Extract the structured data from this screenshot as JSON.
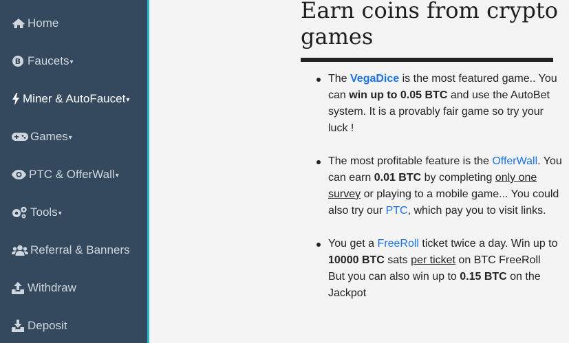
{
  "sidebar": {
    "items": [
      {
        "label": "Home",
        "icon": "home-icon",
        "dropdown": false
      },
      {
        "label": "Faucets",
        "icon": "bitcoin-icon",
        "dropdown": true
      },
      {
        "label": "Miner & AutoFaucet",
        "icon": "bolt-icon",
        "dropdown": true,
        "active": true
      },
      {
        "label": "Games",
        "icon": "gamepad-icon",
        "dropdown": true
      },
      {
        "label": "PTC & OfferWall",
        "icon": "eye-icon",
        "dropdown": true
      },
      {
        "label": "Tools",
        "icon": "cogs-icon",
        "dropdown": true
      },
      {
        "label": "Referral & Banners",
        "icon": "users-icon",
        "dropdown": false
      },
      {
        "label": "Withdraw",
        "icon": "upload-icon",
        "dropdown": false
      },
      {
        "label": "Deposit",
        "icon": "download-icon",
        "dropdown": false
      }
    ],
    "caret": "▾",
    "colors": {
      "background": "#34495e",
      "accent_border": "#26b3c4",
      "text": "#cfd6dd",
      "active_text": "#ffffff"
    }
  },
  "main": {
    "title": "Earn coins from crypto games",
    "colors": {
      "link": "#1a73e8",
      "text": "#222222"
    },
    "vegadice": {
      "t1": "The ",
      "link": "VegaDice",
      "t2": " is the most featured game.. You can ",
      "b1": "win up to 0.05 BTC",
      "t3": " and use the AutoBet system. It is a provably fair game so try your luck !"
    },
    "offerwall": {
      "t1": "The most profitable feature is the ",
      "link": "OfferWall",
      "t2": ". You can earn ",
      "b1": "0.01 BTC",
      "t3": " by completing ",
      "u1": "only one survey",
      "t4": " or playing to a mobile game... You could also try our ",
      "link2": "PTC",
      "t5": ", which pay you to visit links."
    },
    "freeroll": {
      "t1": "You get a ",
      "link": "FreeRoll",
      "t2": " ticket twice a day. Win up to ",
      "b1": "10000 BTC",
      "t3": " sats ",
      "u1": "per ticket",
      "t4": " on BTC FreeRoll",
      "t5": "But you can also win up to ",
      "b2": "0.15 BTC",
      "t6": " on the Jackpot"
    }
  }
}
